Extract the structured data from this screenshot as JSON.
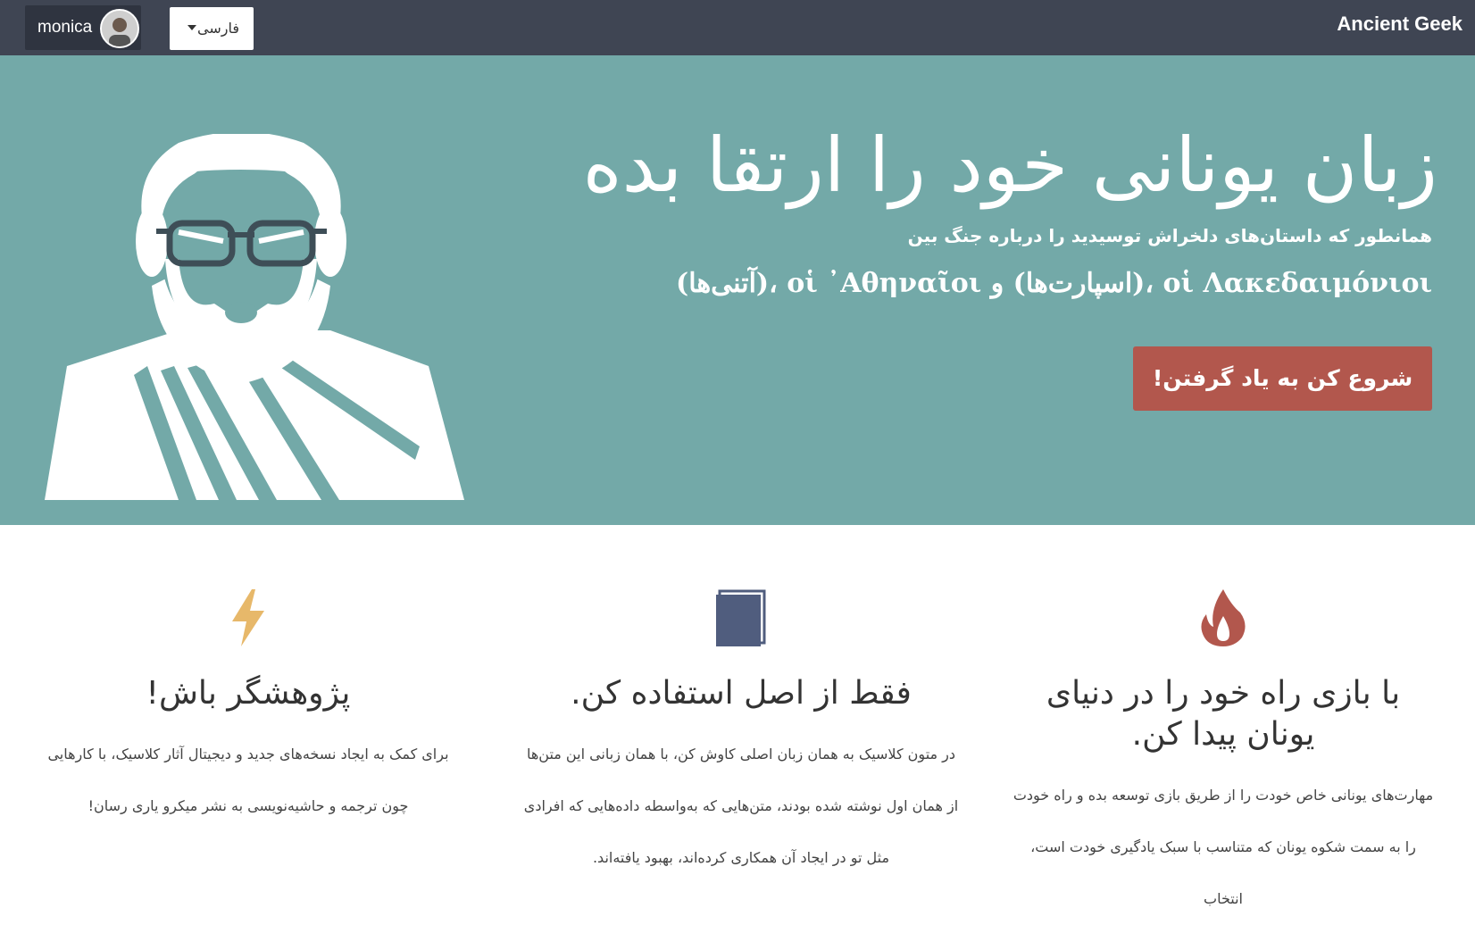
{
  "navbar": {
    "brand": "Ancient Geek",
    "username": "monica",
    "language": "فارسی",
    "avatar_icon": "user-avatar",
    "dropdown_icon": "caret-down-icon"
  },
  "hero": {
    "title": "زبان یونانی خود را ارتقا بده",
    "subtitle_line1": "همانطور که داستان‌های دلخراش توسیدید را درباره جنگ بین",
    "subtitle_line2": "οἱ Λακεδαιμόνιοι ،(اسپارت‌ها) و οἱ ᾿Αθηναῖοι ،(آتنی‌ها)",
    "cta_label": "شروع کن به یاد گرفتن!",
    "image_icon": "socrates-illustration"
  },
  "features": [
    {
      "icon": "lightning-icon",
      "icon_color": "#e7b86a",
      "title": "پژوهشگر باش!",
      "lines": [
        "برای کمک به ایجاد نسخه‌های جدید و دیجیتال آثار کلاسیک، با کارهایی",
        "چون ترجمه و حاشیه‌نویسی به نشر میکرو یاری رسان!"
      ]
    },
    {
      "icon": "book-icon",
      "icon_color": "#505d7e",
      "title": "فقط از اصل استفاده کن.",
      "lines": [
        "در متون کلاسیک به همان زبان اصلی کاوش کن، با همان زبانی این متن‌ها",
        "از همان اول نوشته شده بودند، متن‌هایی که به‌واسطه داده‌هایی که افرادی",
        "مثل تو در ایجاد آن همکاری کرده‌اند، بهبود یافته‌اند."
      ]
    },
    {
      "icon": "fire-icon",
      "icon_color": "#b2574d",
      "title": "با بازی راه خود را در دنیای یونان پیدا کن.",
      "lines": [
        "مهارت‌های یونانی خاص خودت را از طریق بازی توسعه بده و راه خودت",
        "را به سمت شکوه یونان که متناسب با سبک یادگیری خودت است، انتخاب"
      ]
    }
  ],
  "colors": {
    "navbar": "#3f4553",
    "hero": "#73a9a8",
    "cta": "#b2574d"
  }
}
